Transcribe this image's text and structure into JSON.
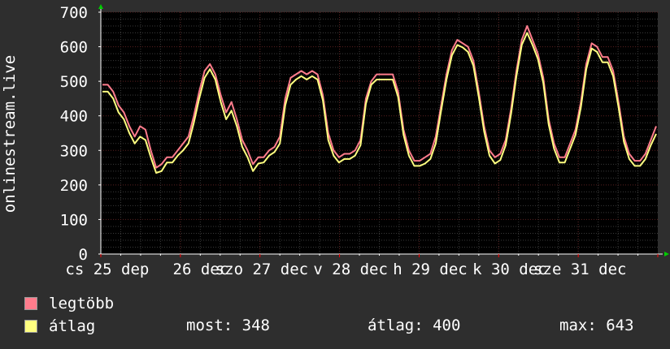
{
  "chart_data": {
    "type": "line",
    "ylabel": "onlinestream.live",
    "ylim": [
      0,
      700
    ],
    "yticks": [
      0,
      100,
      200,
      300,
      400,
      500,
      600,
      700
    ],
    "xtick_labels": [
      "cs 25 dep",
      "26 dec",
      "szo 27 dec",
      "v 28 dec",
      "h 29 dec",
      "k 30 dec",
      "sze 31 dec"
    ],
    "grid": true,
    "legend_placement": "bottom-left",
    "colors": {
      "background": "#2e2e2e",
      "plot_bg": "#000000",
      "grid_major": "#5a2020",
      "grid_minor": "#3a3a3a",
      "max_series": "#ff7c8c",
      "avg_series": "#ffff80",
      "axis": "#ffffff",
      "arrow": "#00cc00"
    },
    "series": [
      {
        "name": "legtöbb",
        "color": "#ff7c8c",
        "values": [
          490,
          490,
          470,
          430,
          410,
          370,
          340,
          370,
          360,
          300,
          250,
          260,
          280,
          280,
          300,
          320,
          340,
          400,
          470,
          530,
          550,
          520,
          460,
          410,
          440,
          390,
          330,
          300,
          260,
          280,
          280,
          300,
          310,
          340,
          450,
          510,
          520,
          530,
          520,
          530,
          520,
          460,
          350,
          300,
          280,
          290,
          290,
          300,
          330,
          450,
          500,
          520,
          520,
          520,
          520,
          470,
          360,
          300,
          270,
          270,
          280,
          290,
          340,
          430,
          520,
          590,
          620,
          610,
          600,
          560,
          470,
          370,
          300,
          280,
          290,
          330,
          420,
          530,
          620,
          660,
          620,
          580,
          510,
          390,
          320,
          280,
          280,
          320,
          360,
          440,
          550,
          610,
          600,
          570,
          570,
          530,
          440,
          340,
          290,
          270,
          270,
          290,
          330,
          370
        ]
      },
      {
        "name": "átlag",
        "color": "#ffff80",
        "values": [
          470,
          470,
          450,
          410,
          390,
          350,
          320,
          340,
          330,
          280,
          235,
          240,
          265,
          265,
          285,
          300,
          320,
          380,
          450,
          510,
          535,
          505,
          440,
          390,
          415,
          370,
          310,
          280,
          240,
          262,
          265,
          285,
          295,
          320,
          430,
          490,
          505,
          515,
          505,
          515,
          505,
          445,
          330,
          285,
          265,
          275,
          275,
          285,
          315,
          435,
          490,
          505,
          505,
          505,
          505,
          455,
          345,
          285,
          255,
          255,
          262,
          275,
          320,
          415,
          505,
          575,
          605,
          598,
          585,
          545,
          455,
          355,
          285,
          262,
          272,
          315,
          405,
          515,
          605,
          640,
          605,
          565,
          495,
          375,
          305,
          265,
          265,
          305,
          345,
          425,
          535,
          595,
          585,
          555,
          555,
          515,
          425,
          325,
          275,
          255,
          255,
          275,
          315,
          348
        ]
      }
    ]
  },
  "legend": {
    "max_label": "legtöbb",
    "avg_label": "átlag"
  },
  "stats": {
    "now": "most: 348",
    "avg": "átlag: 400",
    "max": "max: 643"
  }
}
